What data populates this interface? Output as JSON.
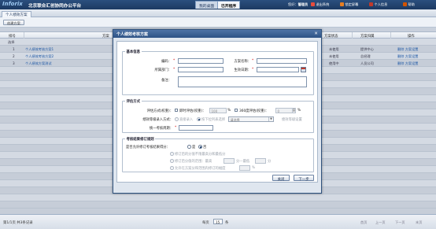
{
  "header": {
    "logo": "Inforix",
    "app_title": "北京联合汇创协同办公平台",
    "tabs": [
      {
        "label": "我的桌面",
        "active": false
      },
      {
        "label": "已开程序",
        "active": true
      }
    ],
    "user_label": "您好：",
    "user_name": "管理员",
    "actions": [
      {
        "label": "退出系统",
        "icon": "logout-icon",
        "color": "#e74c3c"
      },
      {
        "label": "锁定屏幕",
        "icon": "lock-icon",
        "color": "#e67e22"
      },
      {
        "label": "个人信息",
        "icon": "user-icon",
        "color": "#c0392b"
      },
      {
        "label": "帮助",
        "icon": "help-icon",
        "color": "#d35400"
      }
    ]
  },
  "module_tab": {
    "label": "个人绩效方案"
  },
  "toolbar": {
    "create_label": "创建方案"
  },
  "grid": {
    "columns": [
      "排号",
      "方案",
      "方案状态",
      "方案归属",
      "操作"
    ],
    "select_all_label": "选择",
    "rows": [
      {
        "no": "1",
        "name": "个人绩效考核方案1",
        "status": "未使用",
        "owner": "提供中心",
        "ops": "删除 方案设置"
      },
      {
        "no": "2",
        "name": "个人绩效考核方案2",
        "status": "未使用",
        "owner": "总经理",
        "ops": "删除 方案设置"
      },
      {
        "no": "3",
        "name": "个人绩效方案测试",
        "status": "使用中",
        "owner": "人员公司",
        "ops": "删除 方案设置"
      }
    ]
  },
  "footer": {
    "summary": "第1/1页 共3条记录",
    "per_page_label": "每页",
    "per_page_value": "15",
    "per_page_unit": "条",
    "pager": [
      "首页",
      "上一页",
      "下一页",
      "末页"
    ]
  },
  "dialog": {
    "title": "个人绩效考核方案",
    "close_glyph": "✕",
    "basic": {
      "legend": "基本信息",
      "code_label": "编码：",
      "name_label": "方案名称：",
      "dept_label": "所属部门：",
      "date_label": "生效日期：",
      "remark_label": "备注：",
      "required_mark": "*"
    },
    "evaluation": {
      "legend": "评估方式",
      "method_label": "评估方式(权重)：",
      "cb_direct_label": "即时评估(权重)：",
      "direct_weight": "100",
      "pct": "%",
      "cb_360_label": "360度评估(权重)：",
      "weight_360": "0",
      "entry_label": "绩效等级录入方式：",
      "radio_direct": "直接录入",
      "radio_score": "按下拉列表选择",
      "select_placeholder": "请选择",
      "grade_setting_label": "绩效等级设置",
      "cycle_label": "统一考核周期：",
      "cycle_required": "*"
    },
    "rules": {
      "legend": "考核结果修订规则",
      "revise_label": "是否允许修订考核结果得分：",
      "yes_label": "是",
      "no_label": "否",
      "opt1": "修订后的分值不限最高分和最低分",
      "opt2_a": "修订后分值的范围：最高",
      "opt2_b": "分—最低",
      "opt2_c": "分",
      "opt3_a": "允许在方案分和范围内修订的幅度",
      "opt3_b": "%"
    },
    "buttons": {
      "close": "关闭",
      "next": "下一步"
    }
  }
}
